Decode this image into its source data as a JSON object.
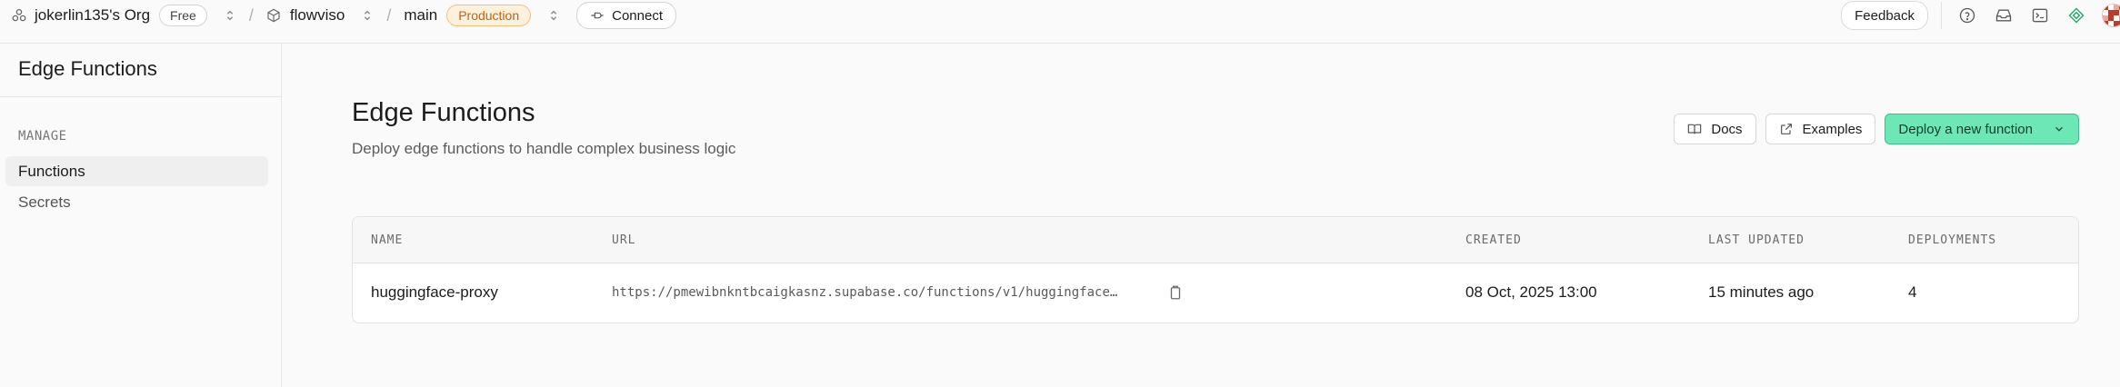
{
  "topbar": {
    "org_name": "jokerlin135's Org",
    "plan": "Free",
    "project_name": "flowviso",
    "branch": "main",
    "env_badge": "Production",
    "connect_label": "Connect",
    "feedback_label": "Feedback",
    "icons": [
      "help-icon",
      "inbox-icon",
      "terminal-icon",
      "assistant-icon",
      "avatar"
    ]
  },
  "sidebar": {
    "title": "Edge Functions",
    "section": "MANAGE",
    "items": [
      {
        "label": "Functions",
        "active": true
      },
      {
        "label": "Secrets",
        "active": false
      }
    ]
  },
  "main": {
    "title": "Edge Functions",
    "subtitle": "Deploy edge functions to handle complex business logic",
    "docs_label": "Docs",
    "examples_label": "Examples",
    "deploy_label": "Deploy a new function",
    "table": {
      "columns": [
        "NAME",
        "URL",
        "CREATED",
        "LAST UPDATED",
        "DEPLOYMENTS"
      ],
      "rows": [
        {
          "name": "huggingface-proxy",
          "url": "https://pmewibnkntbcaigkasnz.supabase.co/functions/v1/huggingface…",
          "created": "08 Oct, 2025 13:00",
          "last_updated": "15 minutes ago",
          "deployments": "4"
        }
      ]
    }
  },
  "colors": {
    "accent": "#6ee7b7",
    "production_badge": "#c2620d",
    "background": "#fafafa"
  }
}
